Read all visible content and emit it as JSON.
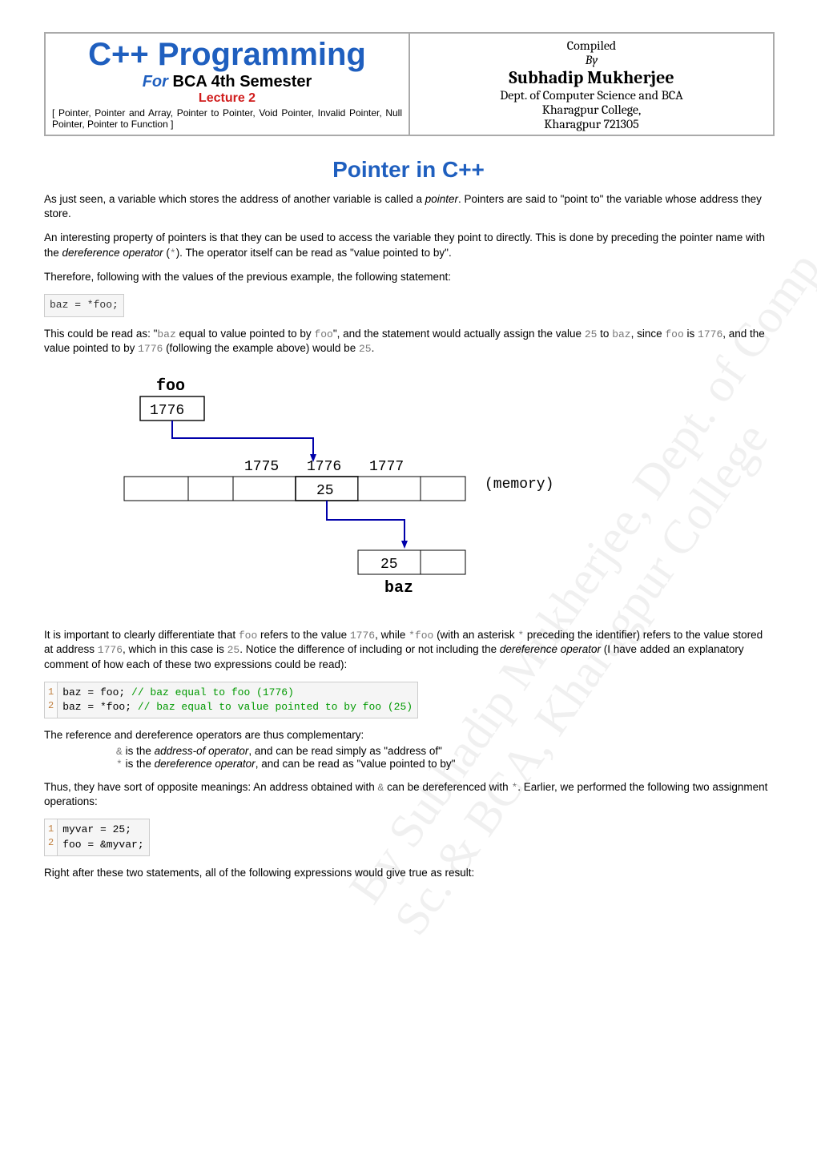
{
  "header": {
    "title_main": "C++ Programming",
    "for_word": "For",
    "title_sub": " BCA 4th Semester",
    "lecture": "Lecture 2",
    "desc": "[ Pointer, Pointer and Array, Pointer to Pointer, Void Pointer, Invalid Pointer, Null Pointer, Pointer to Function ]",
    "compiled": "Compiled",
    "by": "By",
    "author": "Subhadip Mukherjee",
    "dept1": "Dept. of Computer Science and BCA",
    "dept2": "Kharagpur College,",
    "dept3": "Kharagpur 721305"
  },
  "section_title": "Pointer in C++",
  "p1a": "As just seen, a variable which stores the address of another variable is called a ",
  "p1b": "pointer",
  "p1c": ". Pointers are said to \"point to\" the variable whose address they store.",
  "p2a": "An interesting property of pointers is that they can be used to access the variable they point to directly. This is done by preceding the pointer name with the ",
  "p2b": "dereference operator",
  "p2c": " (",
  "p2d": "*",
  "p2e": "). The operator itself can be read as \"value pointed to by\".",
  "p3": "Therefore, following with the values of the previous example, the following statement:",
  "code1": "baz = *foo;",
  "p4a": "This could be read as: \"",
  "p4b": "baz",
  "p4c": " equal to value pointed to by ",
  "p4d": "foo",
  "p4e": "\", and the statement would actually assign the value ",
  "p4f": "25",
  "p4g": " to ",
  "p4h": "baz",
  "p4i": ", since ",
  "p4j": "foo",
  "p4k": " is ",
  "p4l": "1776",
  "p4m": ", and the value pointed to by ",
  "p4n": "1776",
  "p4o": " (following the example above) would be ",
  "p4p": "25",
  "p4q": ".",
  "diagram": {
    "foo_label": "foo",
    "foo_val": "1776",
    "m1": "1775",
    "m2": "1776",
    "m3": "1777",
    "mem_label": "(memory)",
    "val25": "25",
    "baz_val": "25",
    "baz_label": "baz"
  },
  "p5a": "It is important to clearly differentiate that ",
  "p5b": "foo",
  "p5c": " refers to the value ",
  "p5d": "1776",
  "p5e": ", while ",
  "p5f": "*foo",
  "p5g": " (with an asterisk ",
  "p5h": "*",
  "p5i": " preceding the identifier) refers to the value stored at address ",
  "p5j": "1776",
  "p5k": ", which in this case is ",
  "p5l": "25",
  "p5m": ". Notice the difference of including or not including the ",
  "p5n": "dereference operator",
  "p5o": " (I have added an explanatory comment of how each of these two expressions could be read):",
  "code2": {
    "g1": "1",
    "g2": "2",
    "l1a": "baz = foo;   ",
    "l1b": "// baz equal to foo (1776)",
    "l2a": "baz = *foo;  ",
    "l2b": "// baz equal to value pointed to by foo (25)"
  },
  "p6": "The reference and dereference operators are thus complementary:",
  "bullet1a": "&",
  "bullet1b": " is the ",
  "bullet1c": "address-of operator",
  "bullet1d": ", and can be read simply as \"address of\"",
  "bullet2a": "*",
  "bullet2b": " is the ",
  "bullet2c": "dereference operator",
  "bullet2d": ", and can be read as \"value pointed to by\"",
  "p7a": "Thus, they have sort of opposite meanings: An address obtained with ",
  "p7b": "&",
  "p7c": " can be dereferenced with ",
  "p7d": "*",
  "p7e": ". Earlier, we performed the following two assignment operations:",
  "code3": {
    "g1": "1",
    "g2": "2",
    "l1": "myvar = 25;",
    "l2": "foo = &myvar;"
  },
  "p8": "Right after these two statements, all of the following expressions would give true as result:"
}
